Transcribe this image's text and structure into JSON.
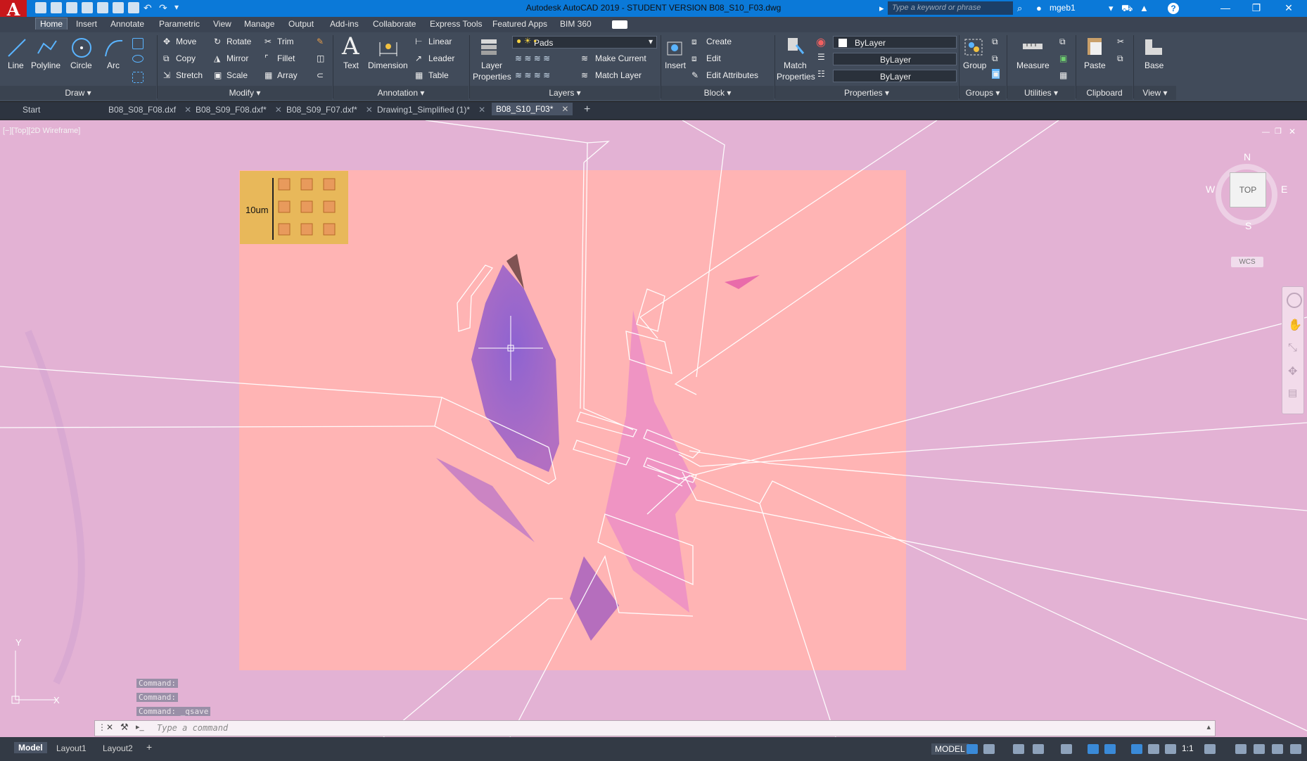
{
  "titlebar": {
    "logo": "A",
    "title": "Autodesk AutoCAD 2019 - STUDENT VERSION    B08_S10_F03.dwg",
    "search_placeholder": "Type a keyword or phrase",
    "username": "mgeb1",
    "help_icon": "?",
    "minimize": "—",
    "restore": "❐",
    "close": "✕"
  },
  "ribbon_tabs": [
    "Home",
    "Insert",
    "Annotate",
    "Parametric",
    "View",
    "Manage",
    "Output",
    "Add-ins",
    "Collaborate",
    "Express Tools",
    "Featured Apps",
    "BIM 360"
  ],
  "ribbon": {
    "draw": {
      "line": "Line",
      "polyline": "Polyline",
      "circle": "Circle",
      "arc": "Arc",
      "footer": "Draw ▾"
    },
    "modify": {
      "move": "Move",
      "rotate": "Rotate",
      "trim": "Trim",
      "copy": "Copy",
      "mirror": "Mirror",
      "fillet": "Fillet",
      "stretch": "Stretch",
      "scale": "Scale",
      "array": "Array",
      "footer": "Modify ▾"
    },
    "annotation": {
      "text": "Text",
      "dimension": "Dimension",
      "linear": "Linear",
      "leader": "Leader",
      "table": "Table",
      "footer": "Annotation ▾"
    },
    "layers": {
      "layer_properties_1": "Layer",
      "layer_properties_2": "Properties",
      "current_layer": "Pads",
      "make_current": "Make Current",
      "match_layer": "Match Layer",
      "footer": "Layers ▾"
    },
    "block": {
      "insert": "Insert",
      "create": "Create",
      "edit": "Edit",
      "edit_attributes": "Edit Attributes",
      "footer": "Block ▾"
    },
    "properties": {
      "match_1": "Match",
      "match_2": "Properties",
      "color": "ByLayer",
      "linetype": "ByLayer",
      "lineweight": "ByLayer",
      "footer": "Properties ▾"
    },
    "groups": {
      "group": "Group",
      "footer": "Groups ▾"
    },
    "utilities": {
      "measure": "Measure",
      "footer": "Utilities ▾"
    },
    "clipboard": {
      "paste": "Paste",
      "footer": "Clipboard"
    },
    "view": {
      "base": "Base",
      "footer": "View ▾"
    }
  },
  "file_tabs": [
    "Start",
    "B08_S08_F08.dxf",
    "B08_S09_F08.dxf*",
    "B08_S09_F07.dxf*",
    "Drawing1_Simplified (1)*",
    "B08_S10_F03*"
  ],
  "viewport": {
    "label": "[−][Top][2D Wireframe]",
    "scale_label": "10um",
    "viewcube": {
      "top": "TOP",
      "north": "N",
      "south": "S",
      "east": "E",
      "west": "W",
      "wcs": "WCS"
    },
    "ucs": {
      "x": "X",
      "y": "Y"
    }
  },
  "command": {
    "history": [
      "Command:",
      "Command:",
      "Command: _qsave"
    ],
    "placeholder": "Type a command"
  },
  "status": {
    "layouts": [
      "Model",
      "Layout1",
      "Layout2"
    ],
    "model_label": "MODEL",
    "scale": "1:1"
  },
  "colors": {
    "titlebar": "#0b79d8",
    "ribbon": "#414b5a",
    "canvas_bg": "#e3b2d4",
    "image_tint": "#ffb4b4",
    "flake": "#8e5cc8",
    "scale_box": "#e8b85a"
  }
}
